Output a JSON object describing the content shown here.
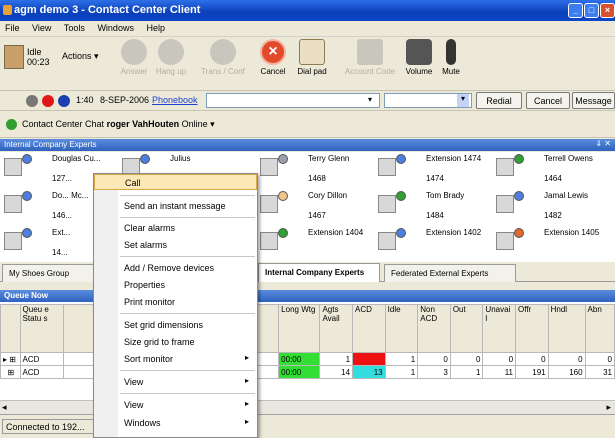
{
  "window": {
    "title": "agm demo 3 - Contact Center Client"
  },
  "menu": [
    "File",
    "View",
    "Tools",
    "Windows",
    "Help"
  ],
  "toolbar": {
    "status_label": "Idle",
    "status_time": "00:23",
    "actions_label": "Actions",
    "buttons": [
      {
        "label": "Answer",
        "enabled": false
      },
      {
        "label": "Hang up",
        "enabled": false
      },
      {
        "label": "Trans / Conf",
        "enabled": false
      },
      {
        "label": "Cancel",
        "enabled": true
      },
      {
        "label": "Dial pad",
        "enabled": true
      },
      {
        "label": "Account Code",
        "enabled": false
      },
      {
        "label": "Volume",
        "enabled": true
      },
      {
        "label": "Mute",
        "enabled": true
      }
    ]
  },
  "addressbar": {
    "time": "1:40",
    "date": "8-SEP-2006",
    "phonebook_link": "Phonebook",
    "redial": "Redial",
    "cancel": "Cancel",
    "message": "Message"
  },
  "chat": {
    "prefix": "Contact Center Chat",
    "user": "roger VahHouten",
    "status": "Online"
  },
  "experts_panel": {
    "title": "Internal Company Experts"
  },
  "contacts": [
    {
      "name": "Douglas Cu...",
      "ext": "127..."
    },
    {
      "name": "Julius",
      "ext": ""
    },
    {
      "name": "Terry Glenn",
      "ext": "1468"
    },
    {
      "name": "Extension 1474",
      "ext": "1474"
    },
    {
      "name": "Terrell Owens",
      "ext": "1464"
    },
    {
      "name": "Do... Mc...",
      "ext": "146..."
    },
    {
      "name": "Cory Dillon",
      "ext": "1467"
    },
    {
      "name": "Tom Brady",
      "ext": "1484"
    },
    {
      "name": "Jamal Lewis",
      "ext": "1482"
    },
    {
      "name": "Ext...",
      "ext": "14..."
    },
    {
      "name": "Extension 1404",
      "ext": ""
    },
    {
      "name": "Extension 1402",
      "ext": ""
    },
    {
      "name": "Extension 1405",
      "ext": ""
    }
  ],
  "tabs": [
    "My Shoes Group",
    "Internal Company Experts",
    "Federated External Experts"
  ],
  "queue": {
    "title": "Queue Now",
    "headers": [
      "Queu e Statu s",
      "Long Wtg",
      "Agts Avail",
      "ACD",
      "Idle",
      "Non ACD",
      "Out",
      "Unavai l",
      "Offr",
      "Hndl",
      "Abn"
    ],
    "rows": [
      {
        "name": "ACD",
        "long_wtg": "00:00",
        "agts_avail": "1",
        "acd": "",
        "idle": "1",
        "non_acd": "0",
        "out": "0",
        "unavail": "0",
        "offr": "0",
        "hndl": "0",
        "abn": "0"
      },
      {
        "name": "ACD",
        "long_wtg": "00:00",
        "agts_avail": "14",
        "acd": "13",
        "idle": "1",
        "non_acd": "3",
        "out": "1",
        "unavail": "11",
        "offr": "191",
        "hndl": "160",
        "abn": "31"
      }
    ]
  },
  "statusbar": {
    "text": "Connected to 192..."
  },
  "context_menu": {
    "items": [
      {
        "label": "Call",
        "highlighted": true,
        "submenu": false
      },
      {
        "label": "Send an instant message",
        "submenu": false
      },
      {
        "label": "Clear alarms",
        "submenu": false
      },
      {
        "label": "Set alarms",
        "submenu": false
      },
      {
        "label": "Add / Remove devices",
        "submenu": false
      },
      {
        "label": "Properties",
        "submenu": false
      },
      {
        "label": "Print monitor",
        "submenu": false
      },
      {
        "label": "Set grid dimensions",
        "submenu": false
      },
      {
        "label": "Size grid to frame",
        "submenu": false
      },
      {
        "label": "Sort monitor",
        "submenu": true
      },
      {
        "label": "View",
        "submenu": true
      },
      {
        "label": "View",
        "submenu": true
      },
      {
        "label": "Windows",
        "submenu": true
      }
    ]
  }
}
